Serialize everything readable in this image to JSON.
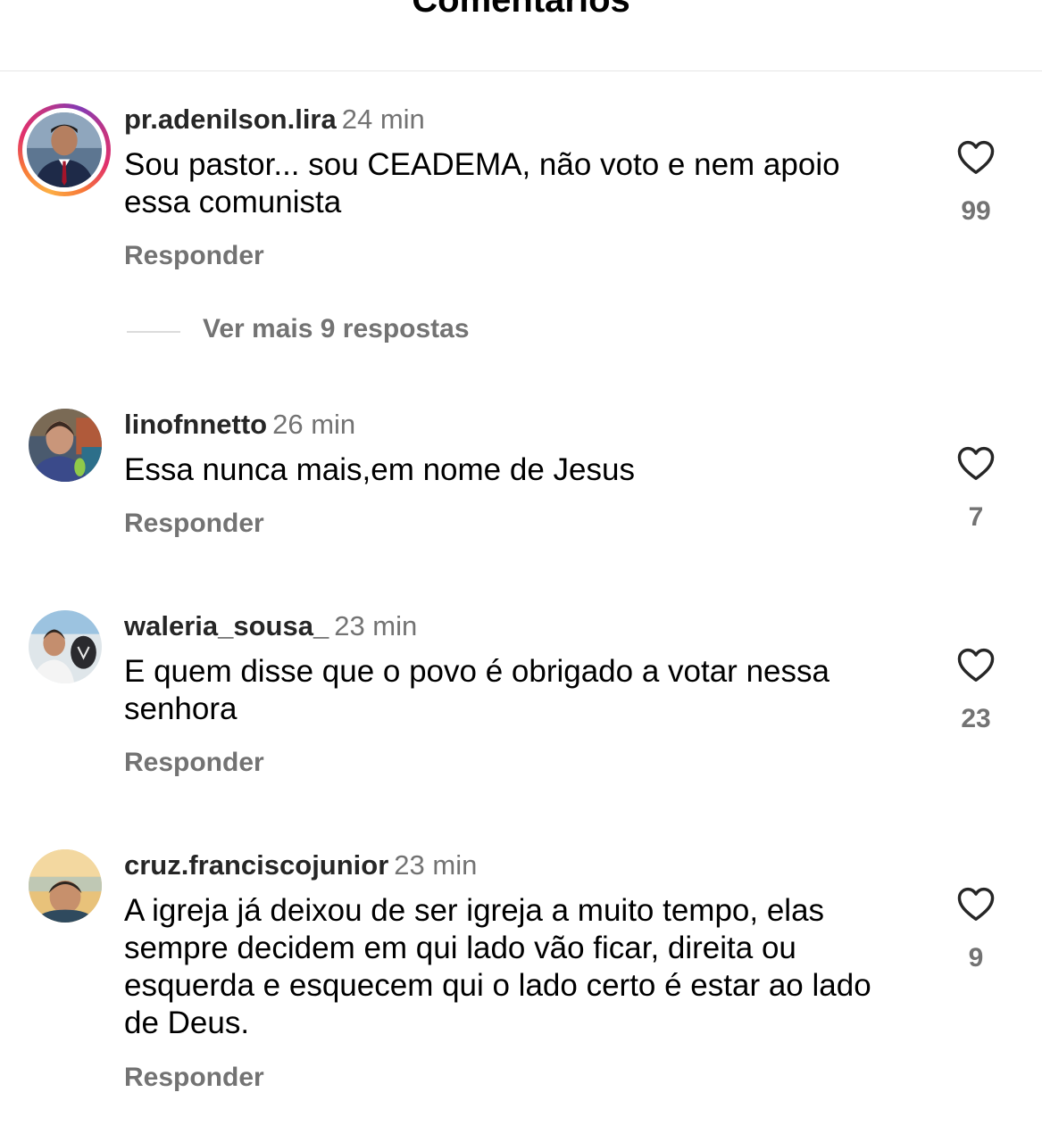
{
  "header": {
    "title": "Comentários"
  },
  "comments": [
    {
      "username": "pr.adenilson.lira",
      "time": "24 min",
      "text": "Sou pastor... sou CEADEMA, não voto e nem apoio essa comunista",
      "reply_label": "Responder",
      "likes": "99",
      "has_story": true
    },
    {
      "username": "linofnnetto",
      "time": "26 min",
      "text": "Essa nunca mais,em nome de Jesus",
      "reply_label": "Responder",
      "likes": "7",
      "has_story": false
    },
    {
      "username": "waleria_sousa_",
      "time": "23 min",
      "text": "E quem disse que o povo é obrigado a votar nessa senhora",
      "reply_label": "Responder",
      "likes": "23",
      "has_story": false
    },
    {
      "username": "cruz.franciscojunior",
      "time": "23 min",
      "text": "A igreja já deixou de ser igreja a muito tempo, elas sempre decidem em qui lado vão ficar, direita ou esquerda e esquecem qui o lado certo é estar ao lado de Deus.",
      "reply_label": "Responder",
      "likes": "9",
      "has_story": false
    }
  ],
  "view_more_replies": "Ver mais 9 respostas",
  "colors": {
    "secondary_text": "#737373",
    "primary_text": "#262626",
    "divider": "#dbdbdb"
  }
}
